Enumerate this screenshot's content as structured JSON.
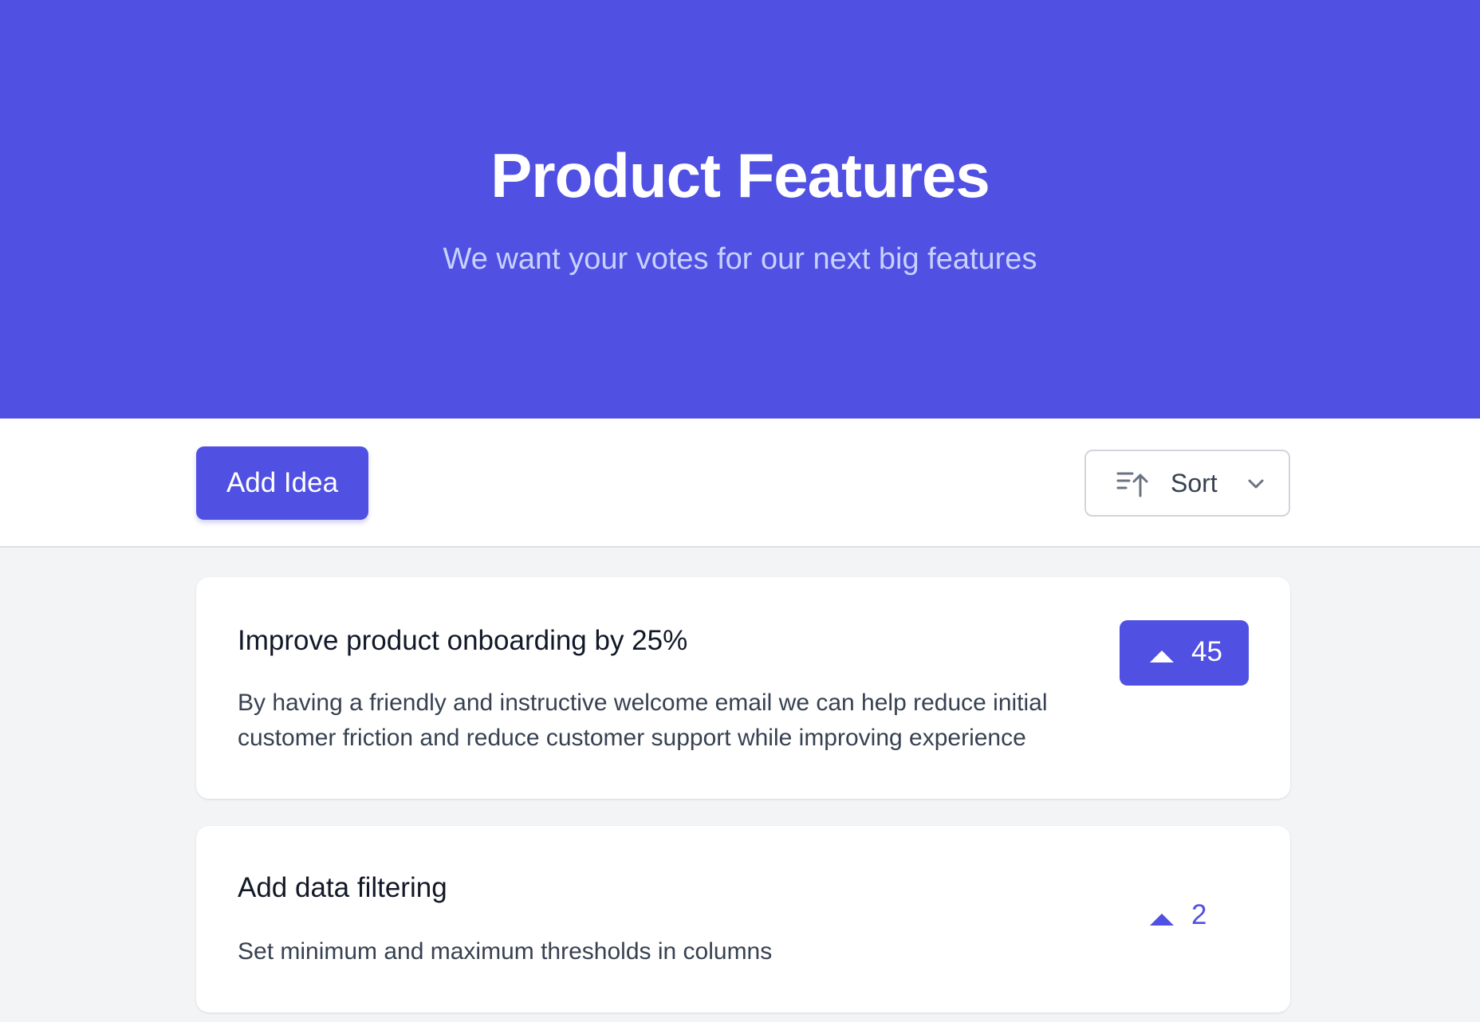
{
  "header": {
    "title": "Product Features",
    "subtitle": "We want your votes for our next big features",
    "background_color": "#5050e2"
  },
  "toolbar": {
    "add_idea_label": "Add Idea",
    "sort_label": "Sort",
    "sort_icon": "sort-ascending-icon",
    "sort_chevron_icon": "chevron-down-icon"
  },
  "features": [
    {
      "title": "Improve product onboarding by 25%",
      "description": "By having a friendly and instructive welcome email we can help reduce initial customer friction and reduce customer support while improving experience",
      "votes": "45",
      "voted": true
    },
    {
      "title": "Add data filtering",
      "description": "Set minimum and maximum thresholds in columns",
      "votes": "2",
      "voted": false
    }
  ],
  "colors": {
    "accent": "#5050e2",
    "page_background": "#f3f4f6",
    "card_background": "#ffffff"
  }
}
